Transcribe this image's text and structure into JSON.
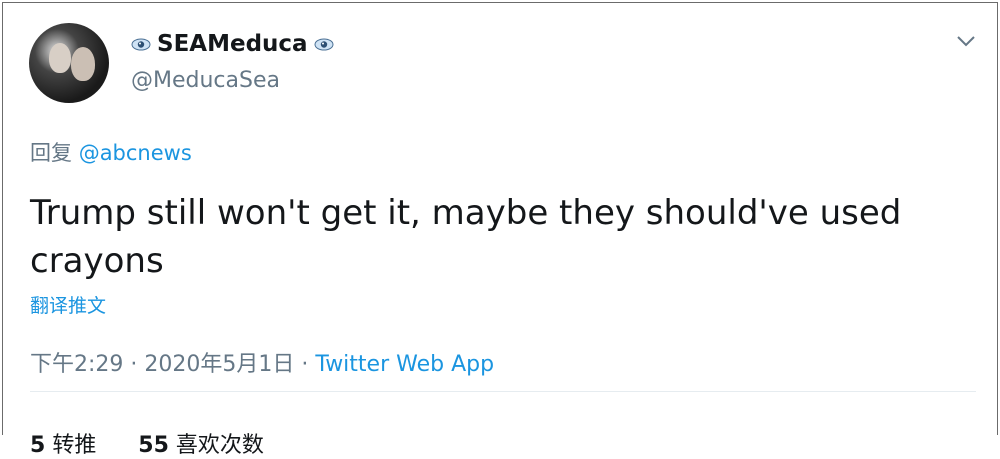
{
  "user": {
    "display_name": "SEAMeduca",
    "handle": "@MeducaSea"
  },
  "reply": {
    "prefix": "回复",
    "mention": "@abcnews"
  },
  "tweet": {
    "text": "Trump still won't get it, maybe they should've used crayons",
    "translate_label": "翻译推文"
  },
  "meta": {
    "time": "下午2:29",
    "sep1": "·",
    "date": "2020年5月1日",
    "sep2": "·",
    "source": "Twitter Web App"
  },
  "stats": {
    "retweets_count": "5",
    "retweets_label": "转推",
    "likes_count": "55",
    "likes_label": "喜欢次数"
  },
  "colors": {
    "link": "#1b95e0",
    "muted": "#657786",
    "text": "#14171a"
  }
}
